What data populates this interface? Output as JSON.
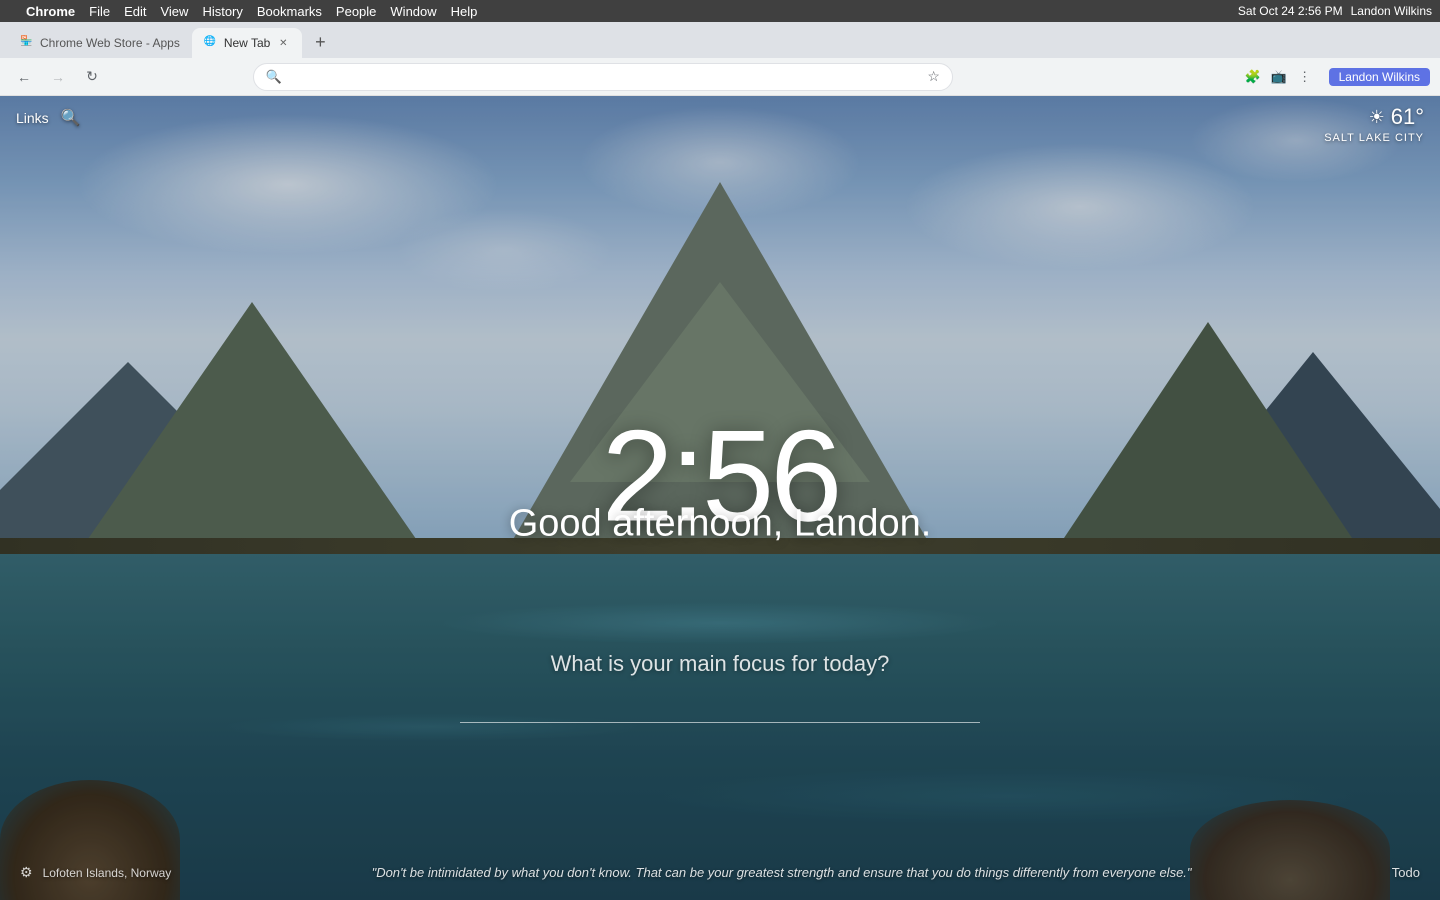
{
  "menubar": {
    "apple_icon": "",
    "items": [
      "Chrome",
      "File",
      "Edit",
      "View",
      "History",
      "Bookmarks",
      "People",
      "Window",
      "Help"
    ],
    "time": "Sat Oct 24  2:56 PM",
    "user": "Landon Wilkins"
  },
  "tabs": [
    {
      "label": "Chrome Web Store - Apps",
      "favicon": "🏪",
      "active": false
    },
    {
      "label": "New Tab",
      "favicon": "",
      "active": true
    }
  ],
  "addressbar": {
    "url": "",
    "placeholder": ""
  },
  "newtab": {
    "links_label": "Links",
    "weather": {
      "icon": "☀",
      "temp": "61°",
      "city": "SALT LAKE CITY"
    },
    "clock": "2:56",
    "greeting": "Good afternoon, Landon.",
    "focus_prompt": "What is your main focus for today?",
    "focus_placeholder": "",
    "quote": "\"Don't be intimidated by what you don't know. That can be your greatest strength and ensure that you do things differently from everyone else.\"",
    "location": "Lofoten Islands, Norway",
    "todo_label": "Todo"
  }
}
